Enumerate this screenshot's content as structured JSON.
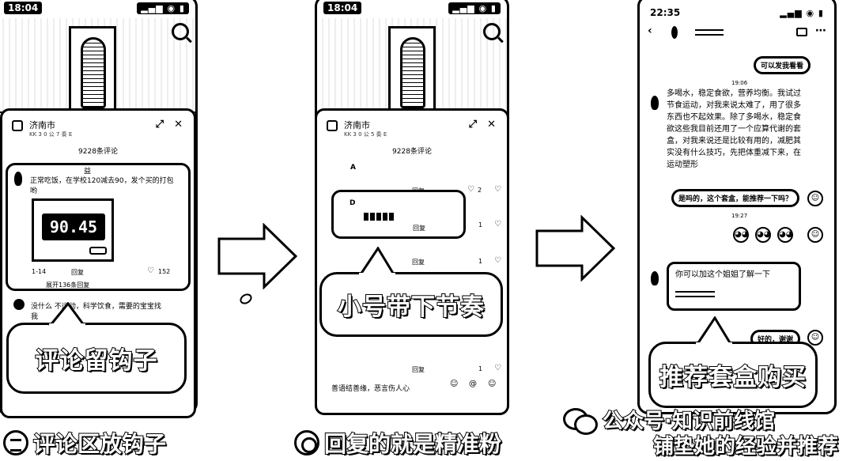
{
  "panel1": {
    "status": {
      "time": "18:04",
      "signal": "▂▄▆ ◉ ▮"
    },
    "sheet": {
      "location": "济南市",
      "sub": "KK 3 0 公 7 奏 E",
      "comment_count": "9228条评论",
      "top_comment": {
        "name": "益",
        "text_line1": "正常吃饭，在学校120减去90，发个买的打包",
        "text_line2": "哟",
        "scale_reading": "90.45",
        "time": "1-14",
        "reply": "回复",
        "likes": "152",
        "expand": "展开136条回复"
      },
      "second_comment": {
        "text_line1": "没什么 不运动，科学饮食，需要的宝宝找",
        "text_line2": "我"
      }
    },
    "label": "评论留钩子",
    "caption": "评论区放钩子"
  },
  "panel2": {
    "status": {
      "time": "18:04",
      "signal": "▂▄▆ ◉ ▮"
    },
    "sheet": {
      "location": "济南市",
      "sub": "KK 3 0 公 5 奏 E",
      "comment_count": "9228条评论",
      "row1_name": "A",
      "row1_reply": "回复",
      "row1_likes": "2",
      "boxed_name": "D",
      "boxed_reply": "回复",
      "boxed_likes": "1",
      "row3_reply": "回复",
      "row3_likes": "1",
      "row4_reply": "回复",
      "row4_likes": "1",
      "input_placeholder": "善语结善缘，恶言伤人心"
    },
    "label": "小号带下节奏",
    "caption": "回复的就是精准粉"
  },
  "panel3": {
    "status": {
      "time": "22:35",
      "signal": "▂▄▆ ◉ ▮"
    },
    "chat": {
      "pill_top": "可以发我看看",
      "ts1": "19:06",
      "long_message": "多喝水，稳定食欲，营养均衡。我试过节食运动，对我来说太难了，用了很多东西也不起效果。除了多喝水，稳定食欲这些我目前还用了一个应算代谢的套盒，对我来说还是比较有用的，减肥其实没有什么技巧，先把体重减下来，在运动塑形",
      "pill_mid": "是吗的，这个套盒，能推荐一下吗？",
      "ts2": "19:27",
      "ts3": "",
      "recommend_text": "你可以加这个姐姐了解一下",
      "ts4": "",
      "pill_bottom": "好的，谢谢"
    },
    "label": "推荐套盒购买",
    "watermark": "公众号·知识前线馆",
    "caption": "铺垫她的经验并推荐"
  },
  "icons": [
    "search-icon",
    "share-icon",
    "close-icon",
    "heart-icon",
    "back-icon",
    "video-icon",
    "wechat-icon",
    "list-icon",
    "target-icon",
    "emoji-icon",
    "at-icon"
  ]
}
